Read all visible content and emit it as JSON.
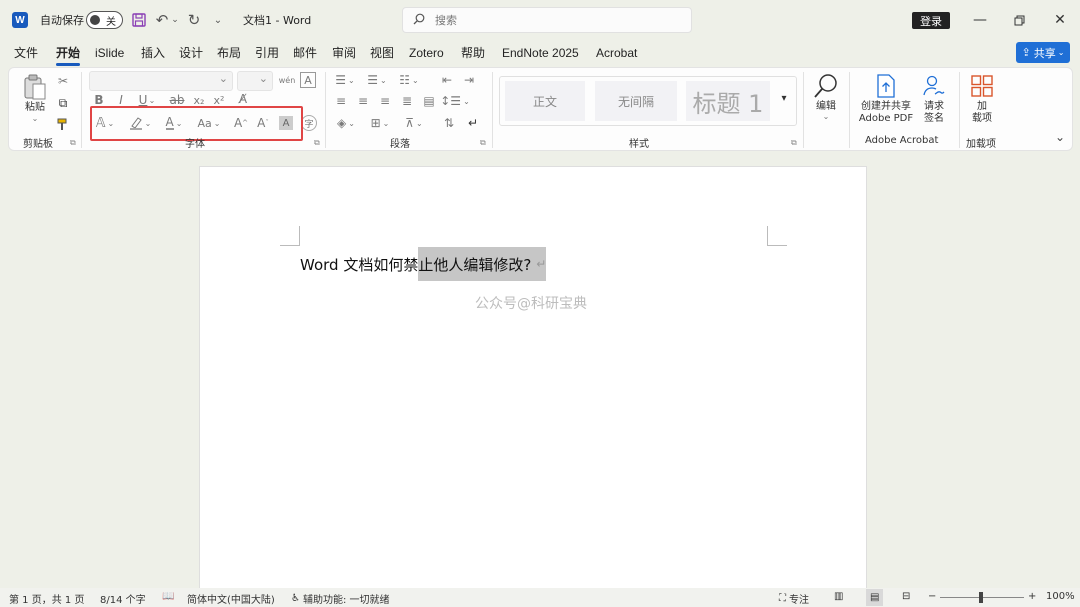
{
  "titlebar": {
    "autosave_label": "自动保存",
    "autosave_state": "关",
    "doc_title": "文档1 - Word",
    "search_placeholder": "搜索",
    "login_label": "登录"
  },
  "tabs": [
    "文件",
    "开始",
    "iSlide",
    "插入",
    "设计",
    "布局",
    "引用",
    "邮件",
    "审阅",
    "视图",
    "Zotero",
    "帮助",
    "EndNote 2025",
    "Acrobat"
  ],
  "active_tab": "开始",
  "share_label": "共享",
  "ribbon": {
    "clipboard": {
      "paste_label": "粘贴",
      "group_label": "剪贴板"
    },
    "font": {
      "group_label": "字体"
    },
    "paragraph": {
      "group_label": "段落"
    },
    "styles": {
      "group_label": "样式",
      "items": [
        "正文",
        "无间隔",
        "标题 1"
      ]
    },
    "editing": {
      "label": "编辑"
    },
    "adobe": {
      "create_label_1": "创建并共享",
      "create_label_2": "Adobe PDF",
      "sign_label_1": "请求",
      "sign_label_2": "签名",
      "group_label": "Adobe Acrobat"
    },
    "addins": {
      "label_1": "加",
      "label_2": "载项",
      "group_label": "加载项"
    }
  },
  "document": {
    "text_normal": "Word 文档如何禁",
    "text_selected": "止他人编辑修改?",
    "watermark": "公众号@科研宝典"
  },
  "statusbar": {
    "page": "第 1 页，共 1 页",
    "words": "8/14 个字",
    "language": "简体中文(中国大陆)",
    "accessibility": "辅助功能: 一切就绪",
    "focus": "专注",
    "zoom": "100%"
  },
  "colors": {
    "accent": "#185abd",
    "highlight_box": "#e04545",
    "selection": "#c6c6c6"
  }
}
